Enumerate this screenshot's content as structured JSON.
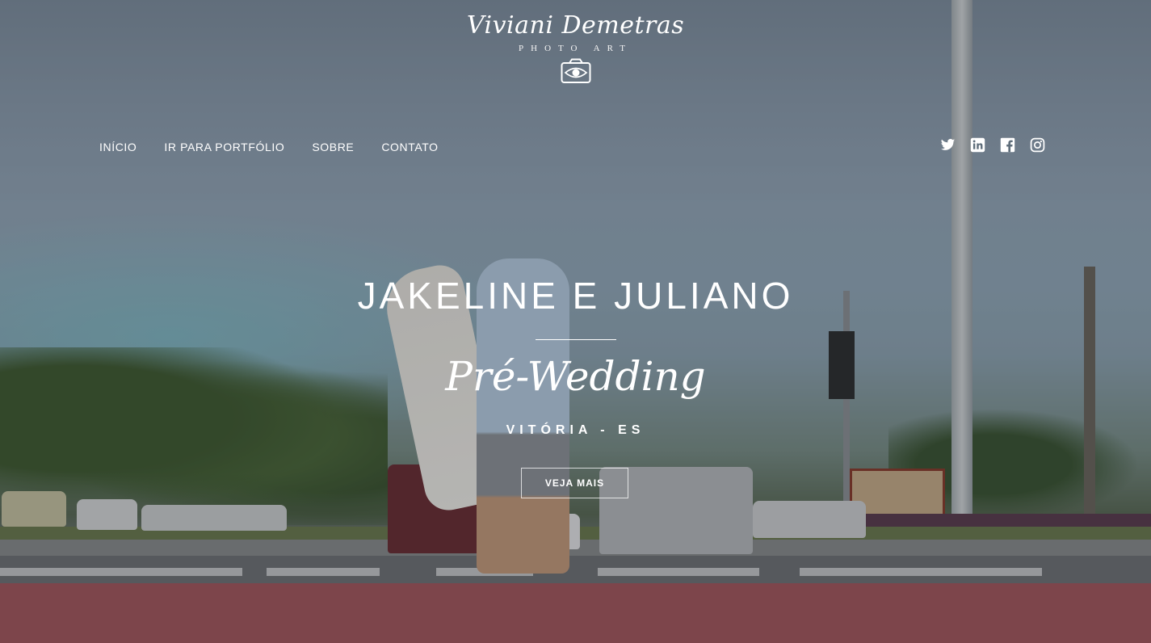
{
  "brand": {
    "name": "Viviani Demetras",
    "tagline": "PHOTO ART",
    "camera_icon": "camera-eye-icon"
  },
  "nav": {
    "items": [
      {
        "label": "INÍCIO"
      },
      {
        "label": "IR PARA PORTFÓLIO"
      },
      {
        "label": "SOBRE"
      },
      {
        "label": "CONTATO"
      }
    ]
  },
  "social": {
    "icons": [
      "twitter-icon",
      "linkedin-icon",
      "facebook-icon",
      "instagram-icon"
    ]
  },
  "hero": {
    "title": "JAKELINE E JULIANO",
    "subtitle": "Pré-Wedding",
    "location": "VITÓRIA - ES",
    "cta_label": "VEJA MAIS"
  },
  "colors": {
    "text": "#ffffff",
    "bike_path": "#a5565d"
  }
}
